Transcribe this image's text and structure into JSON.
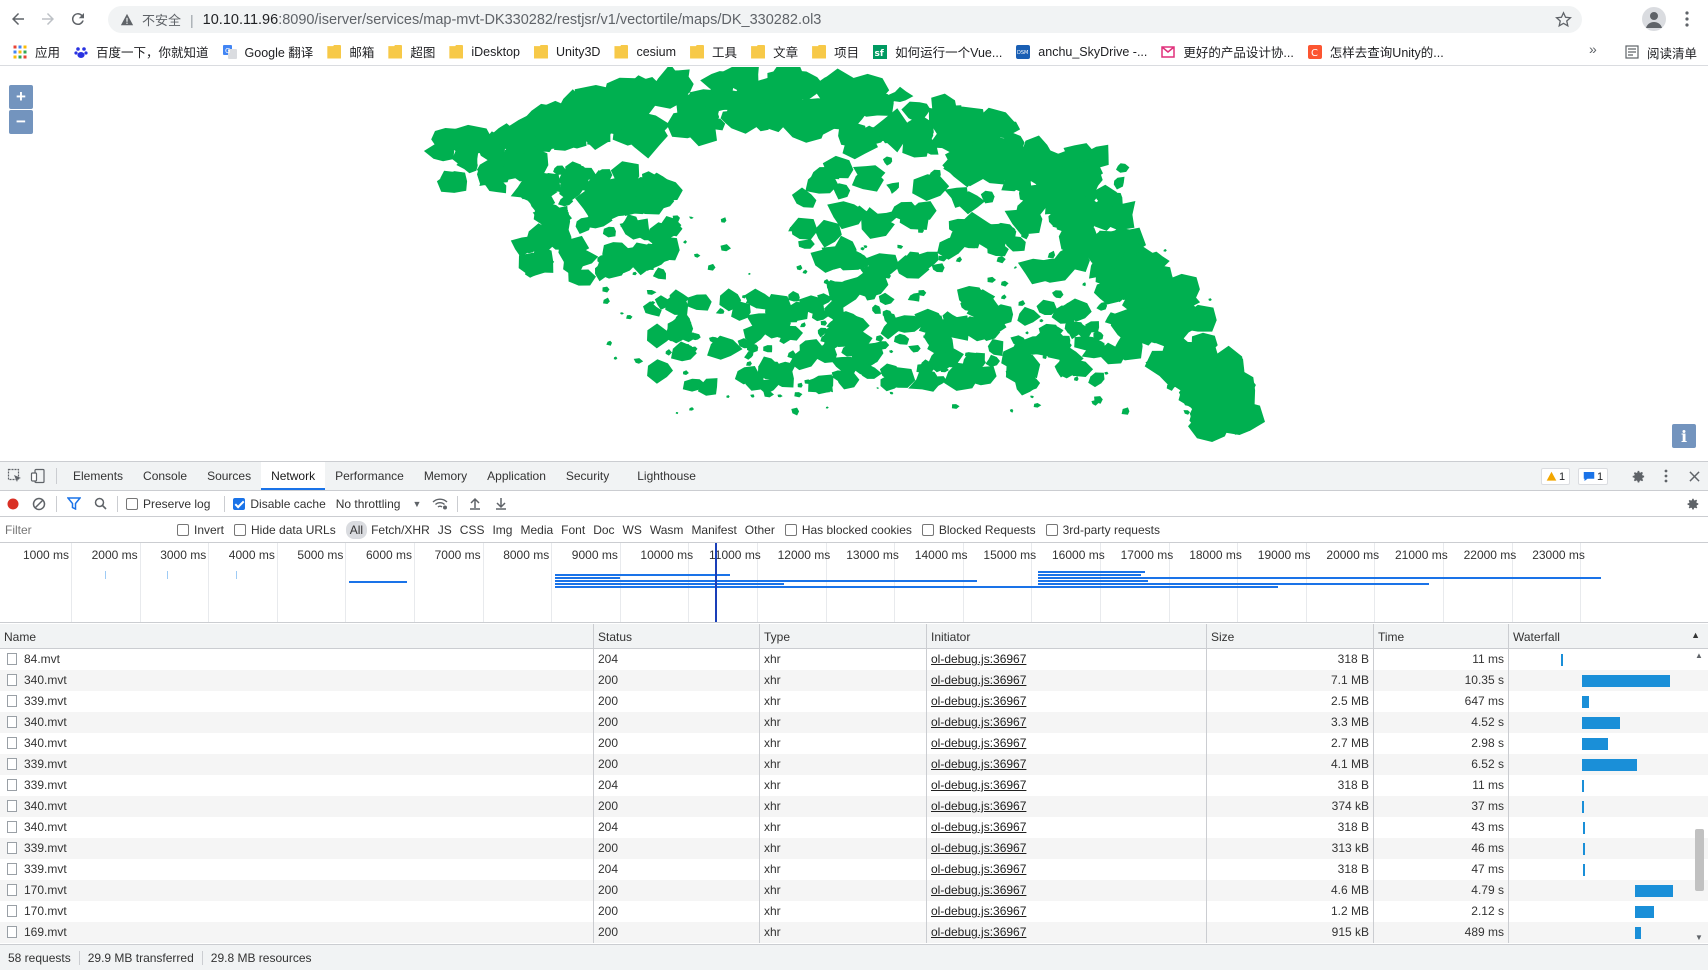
{
  "browser": {
    "insecure_label": "不安全",
    "url_host": "10.10.11.96",
    "url_rest": ":8090/iserver/services/map-mvt-DK330282/restjsr/v1/vectortile/maps/DK_330282.ol3"
  },
  "bookmarks": [
    {
      "label": "应用",
      "icon": "apps-grid-icon"
    },
    {
      "label": "百度一下，你就知道",
      "icon": "baidu-icon"
    },
    {
      "label": "Google 翻译",
      "icon": "google-translate-icon"
    },
    {
      "label": "邮箱",
      "icon": "folder-icon"
    },
    {
      "label": "超图",
      "icon": "folder-icon"
    },
    {
      "label": "iDesktop",
      "icon": "folder-icon"
    },
    {
      "label": "Unity3D",
      "icon": "folder-icon"
    },
    {
      "label": "cesium",
      "icon": "folder-icon"
    },
    {
      "label": "工具",
      "icon": "folder-icon"
    },
    {
      "label": "文章",
      "icon": "folder-icon"
    },
    {
      "label": "项目",
      "icon": "folder-icon"
    },
    {
      "label": "如何运行一个Vue...",
      "icon": "segmentfault-icon"
    },
    {
      "label": "anchu_SkyDrive -...",
      "icon": "dsm-icon"
    },
    {
      "label": "更好的产品设计协...",
      "icon": "mockplus-icon"
    },
    {
      "label": "怎样去查询Unity的...",
      "icon": "csdn-icon"
    }
  ],
  "bookmarks_more": "»",
  "reading_list": "阅读清单",
  "map": {
    "zoom_in": "+",
    "zoom_out": "−",
    "attribution": "i",
    "fill_color": "#00b050"
  },
  "devtools": {
    "tabs": [
      "Elements",
      "Console",
      "Sources",
      "Network",
      "Performance",
      "Memory",
      "Application",
      "Security",
      "Lighthouse"
    ],
    "active_tab": "Network",
    "warn_count": "1",
    "msg_count": "1",
    "toolbar": {
      "preserve_log": "Preserve log",
      "disable_cache": "Disable cache",
      "throttling": "No throttling"
    },
    "filter": {
      "placeholder": "Filter",
      "invert": "Invert",
      "hide_data_urls": "Hide data URLs",
      "types": [
        "All",
        "Fetch/XHR",
        "JS",
        "CSS",
        "Img",
        "Media",
        "Font",
        "Doc",
        "WS",
        "Wasm",
        "Manifest",
        "Other"
      ],
      "active_type": "All",
      "has_blocked_cookies": "Has blocked cookies",
      "blocked_requests": "Blocked Requests",
      "third_party": "3rd-party requests"
    },
    "overview_ticks": [
      "1000 ms",
      "2000 ms",
      "3000 ms",
      "4000 ms",
      "5000 ms",
      "6000 ms",
      "7000 ms",
      "8000 ms",
      "9000 ms",
      "10000 ms",
      "11000 ms",
      "12000 ms",
      "13000 ms",
      "14000 ms",
      "15000 ms",
      "16000 ms",
      "17000 ms",
      "18000 ms",
      "19000 ms",
      "20000 ms",
      "21000 ms",
      "22000 ms",
      "23000 ms"
    ],
    "columns": [
      "Name",
      "Status",
      "Type",
      "Initiator",
      "Size",
      "Time",
      "Waterfall"
    ],
    "rows": [
      {
        "name": "84.mvt",
        "status": "204",
        "type": "xhr",
        "initiator": "ol-debug.js:36967",
        "size": "318 B",
        "time": "11 ms",
        "wf_start": 0.25,
        "wf_len": 0.01
      },
      {
        "name": "340.mvt",
        "status": "200",
        "type": "xhr",
        "initiator": "ol-debug.js:36967",
        "size": "7.1 MB",
        "time": "10.35 s",
        "wf_start": 0.36,
        "wf_len": 0.46
      },
      {
        "name": "339.mvt",
        "status": "200",
        "type": "xhr",
        "initiator": "ol-debug.js:36967",
        "size": "2.5 MB",
        "time": "647 ms",
        "wf_start": 0.36,
        "wf_len": 0.04
      },
      {
        "name": "340.mvt",
        "status": "200",
        "type": "xhr",
        "initiator": "ol-debug.js:36967",
        "size": "3.3 MB",
        "time": "4.52 s",
        "wf_start": 0.36,
        "wf_len": 0.2
      },
      {
        "name": "340.mvt",
        "status": "200",
        "type": "xhr",
        "initiator": "ol-debug.js:36967",
        "size": "2.7 MB",
        "time": "2.98 s",
        "wf_start": 0.36,
        "wf_len": 0.14
      },
      {
        "name": "339.mvt",
        "status": "200",
        "type": "xhr",
        "initiator": "ol-debug.js:36967",
        "size": "4.1 MB",
        "time": "6.52 s",
        "wf_start": 0.36,
        "wf_len": 0.29
      },
      {
        "name": "339.mvt",
        "status": "204",
        "type": "xhr",
        "initiator": "ol-debug.js:36967",
        "size": "318 B",
        "time": "11 ms",
        "wf_start": 0.36,
        "wf_len": 0.01
      },
      {
        "name": "340.mvt",
        "status": "200",
        "type": "xhr",
        "initiator": "ol-debug.js:36967",
        "size": "374 kB",
        "time": "37 ms",
        "wf_start": 0.36,
        "wf_len": 0.012
      },
      {
        "name": "340.mvt",
        "status": "204",
        "type": "xhr",
        "initiator": "ol-debug.js:36967",
        "size": "318 B",
        "time": "43 ms",
        "wf_start": 0.365,
        "wf_len": 0.012
      },
      {
        "name": "339.mvt",
        "status": "200",
        "type": "xhr",
        "initiator": "ol-debug.js:36967",
        "size": "313 kB",
        "time": "46 ms",
        "wf_start": 0.365,
        "wf_len": 0.012
      },
      {
        "name": "339.mvt",
        "status": "204",
        "type": "xhr",
        "initiator": "ol-debug.js:36967",
        "size": "318 B",
        "time": "47 ms",
        "wf_start": 0.365,
        "wf_len": 0.012
      },
      {
        "name": "170.mvt",
        "status": "200",
        "type": "xhr",
        "initiator": "ol-debug.js:36967",
        "size": "4.6 MB",
        "time": "4.79 s",
        "wf_start": 0.64,
        "wf_len": 0.2
      },
      {
        "name": "170.mvt",
        "status": "200",
        "type": "xhr",
        "initiator": "ol-debug.js:36967",
        "size": "1.2 MB",
        "time": "2.12 s",
        "wf_start": 0.64,
        "wf_len": 0.1
      },
      {
        "name": "169.mvt",
        "status": "200",
        "type": "xhr",
        "initiator": "ol-debug.js:36967",
        "size": "915 kB",
        "time": "489 ms",
        "wf_start": 0.64,
        "wf_len": 0.03
      }
    ],
    "status_bar": {
      "requests": "58 requests",
      "transferred": "29.9 MB transferred",
      "resources": "29.8 MB resources"
    }
  }
}
